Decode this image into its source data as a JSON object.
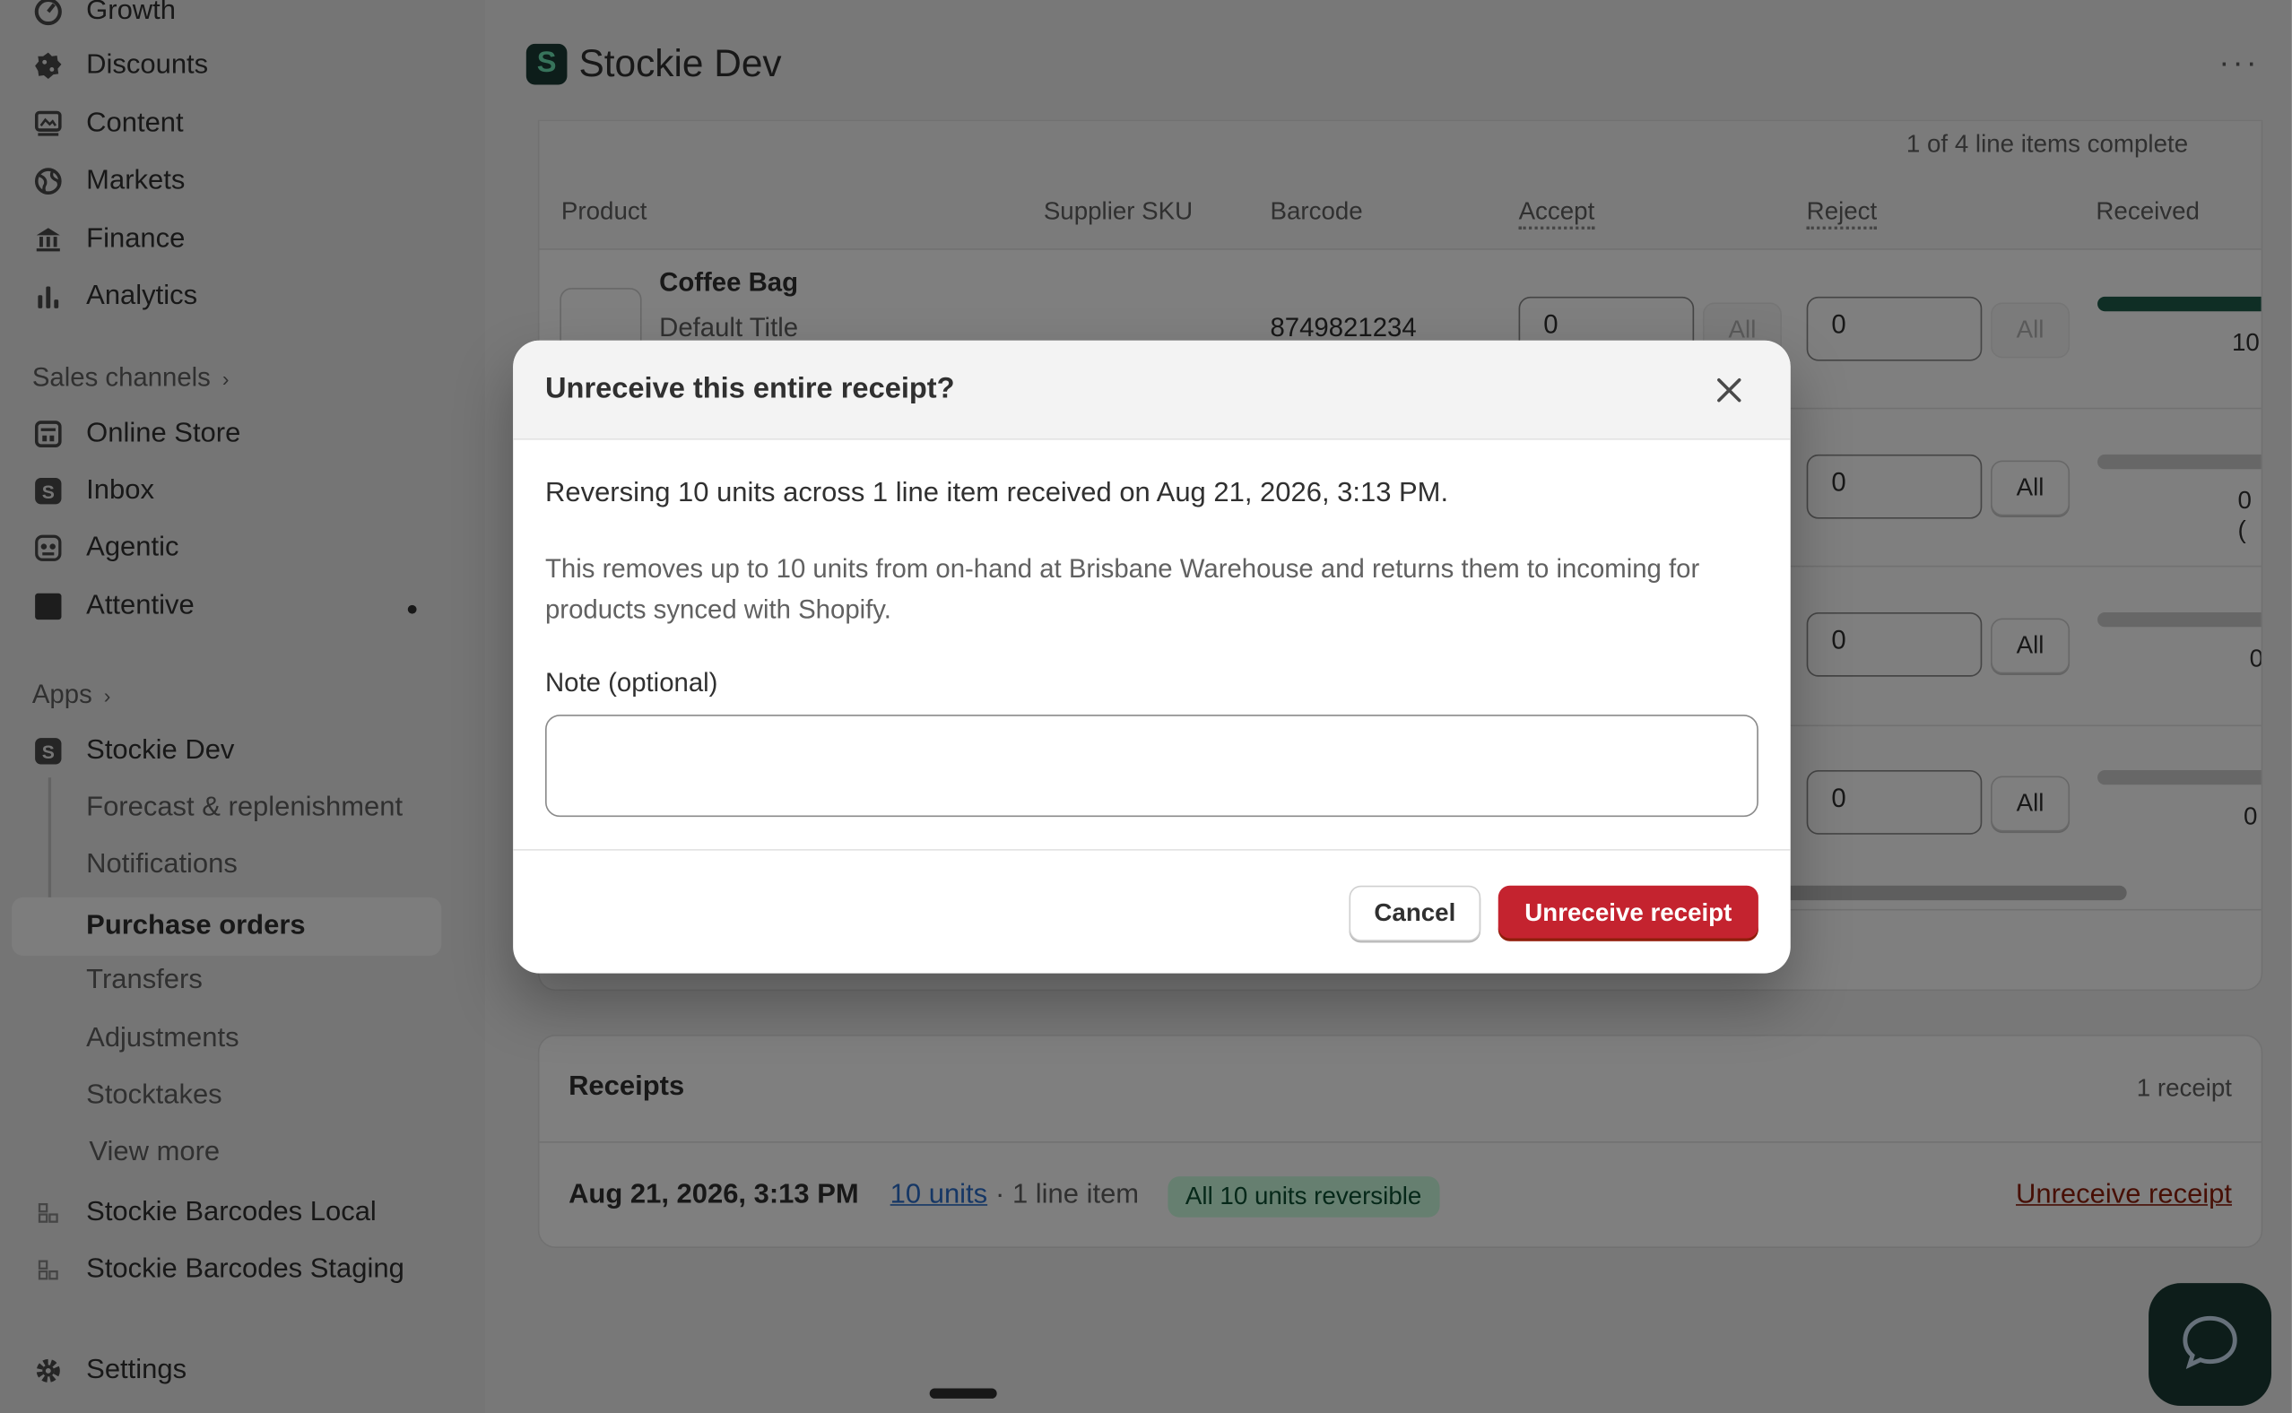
{
  "sidebar": {
    "items_top": [
      {
        "label": "Growth",
        "icon": "growth-icon"
      },
      {
        "label": "Discounts",
        "icon": "discount-icon"
      },
      {
        "label": "Content",
        "icon": "content-icon"
      },
      {
        "label": "Markets",
        "icon": "globe-icon"
      },
      {
        "label": "Finance",
        "icon": "bank-icon"
      },
      {
        "label": "Analytics",
        "icon": "bar-chart-icon"
      }
    ],
    "sales_channels_label": "Sales channels",
    "sales_channels": [
      {
        "label": "Online Store",
        "icon": "store-icon"
      },
      {
        "label": "Inbox",
        "icon": "inbox-icon"
      },
      {
        "label": "Agentic",
        "icon": "robot-icon"
      },
      {
        "label": "Attentive",
        "icon": "attentive-icon"
      }
    ],
    "apps_label": "Apps",
    "app_name": "Stockie Dev",
    "app_subitems": [
      {
        "label": "Forecast & replenishment"
      },
      {
        "label": "Notifications"
      },
      {
        "label": "Purchase orders"
      },
      {
        "label": "Transfers"
      },
      {
        "label": "Adjustments"
      },
      {
        "label": "Stocktakes"
      }
    ],
    "view_more": "View more",
    "other_apps": [
      {
        "label": "Stockie Barcodes Local"
      },
      {
        "label": "Stockie Barcodes Staging"
      }
    ],
    "settings": "Settings"
  },
  "header": {
    "app_logo_letter": "S",
    "title": "Stockie Dev",
    "more": "···"
  },
  "items": {
    "complete_text": "1 of 4 line items complete",
    "columns": [
      "Product",
      "Supplier SKU",
      "Barcode",
      "Accept",
      "Reject",
      "Received"
    ],
    "first_row": {
      "name": "Coffee Bag",
      "variant": "Default Title",
      "barcode": "8749821234",
      "accept": "0",
      "reject": "0",
      "received": "10"
    },
    "other_rows": [
      {
        "reject": "0",
        "received": "0 ("
      },
      {
        "reject": "0",
        "received": "0"
      },
      {
        "reject": "0",
        "received": "0"
      }
    ],
    "all_label": "All"
  },
  "receipts": {
    "title": "Receipts",
    "count": "1 receipt",
    "date": "Aug 21, 2026, 3:13 PM",
    "units": "10 units",
    "lines": "· 1 line item",
    "badge": "All 10 units reversible",
    "action": "Unreceive receipt"
  },
  "modal": {
    "title": "Unreceive this entire receipt?",
    "line1": "Reversing 10 units across 1 line item received on Aug 21, 2026, 3:13 PM.",
    "line2": "This removes up to 10 units from on-hand at Brisbane Warehouse and returns them to incoming for products synced with Shopify.",
    "note_label": "Note (optional)",
    "note_value": "",
    "cancel": "Cancel",
    "confirm": "Unreceive receipt"
  },
  "colors": {
    "danger": "#c4232f",
    "brand_dark": "#1a3b34",
    "badge_bg": "#cdfee1"
  }
}
